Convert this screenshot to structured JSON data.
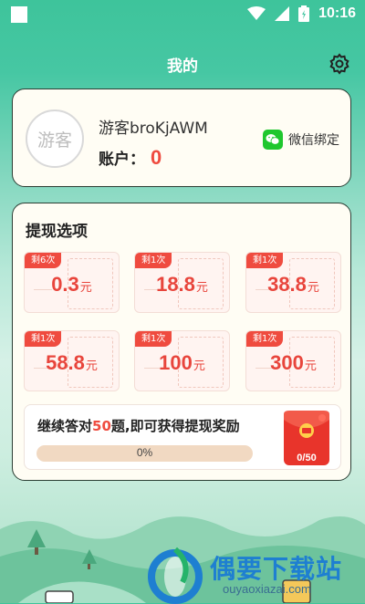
{
  "status_bar": {
    "time": "10:16"
  },
  "header": {
    "title": "我的",
    "settings_icon": "gear-icon"
  },
  "profile": {
    "avatar_text": "游客",
    "username": "游客broKjAWM",
    "account_label": "账户：",
    "account_value": "0",
    "wechat_bind_label": "微信绑定",
    "wechat_icon": "wechat-icon"
  },
  "withdraw": {
    "title": "提现选项",
    "options": [
      {
        "badge": "剩6次",
        "amount": "0.3",
        "unit": "元"
      },
      {
        "badge": "剩1次",
        "amount": "18.8",
        "unit": "元"
      },
      {
        "badge": "剩1次",
        "amount": "38.8",
        "unit": "元"
      },
      {
        "badge": "剩1次",
        "amount": "58.8",
        "unit": "元"
      },
      {
        "badge": "剩1次",
        "amount": "100",
        "unit": "元"
      },
      {
        "badge": "剩1次",
        "amount": "300",
        "unit": "元"
      }
    ],
    "progress": {
      "text_before": "继续答对",
      "highlight": "50",
      "text_after": "题,即可获得提现奖励",
      "percent_label": "0%",
      "fraction": 0,
      "count_label": "0/50"
    }
  },
  "watermark": {
    "title": "偶要下载站",
    "sub": "ouyaoxiazai.com"
  },
  "colors": {
    "accent_red": "#ef4b3f",
    "wechat_green": "#1fc72e",
    "header_green": "#3ec49b"
  }
}
